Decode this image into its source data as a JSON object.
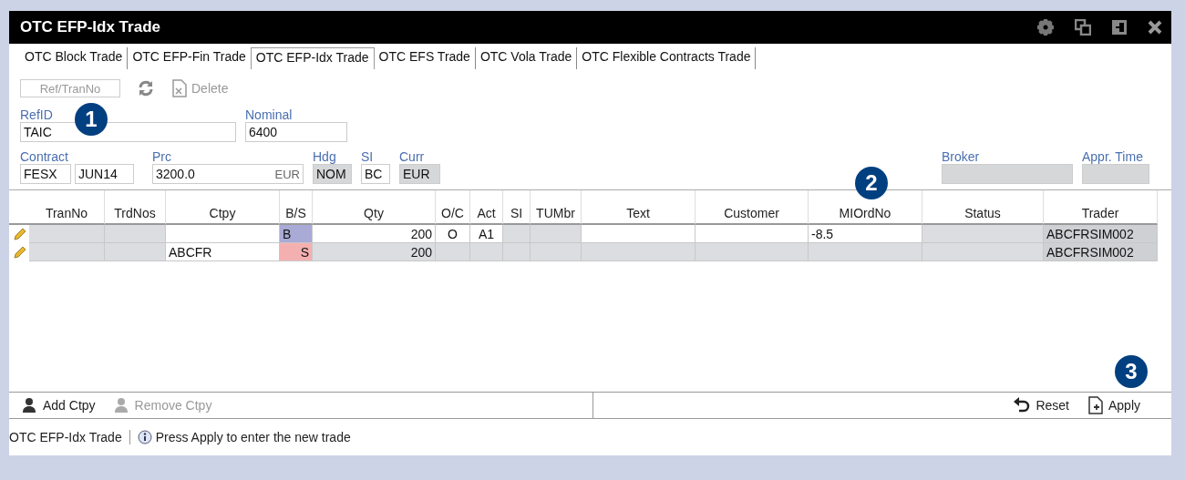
{
  "window": {
    "title": "OTC EFP-Idx Trade"
  },
  "tabs": [
    {
      "label": "OTC Block Trade",
      "selected": false
    },
    {
      "label": "OTC EFP-Fin Trade",
      "selected": false
    },
    {
      "label": "OTC EFP-Idx Trade",
      "selected": true
    },
    {
      "label": "OTC EFS Trade",
      "selected": false
    },
    {
      "label": "OTC Vola Trade",
      "selected": false
    },
    {
      "label": "OTC Flexible Contracts Trade",
      "selected": false
    }
  ],
  "toolbar": {
    "ref_field": {
      "placeholder": "Ref/TranNo",
      "disabled": true
    },
    "delete_label": "Delete"
  },
  "form_row_1": [
    {
      "label": "RefID",
      "values": [
        "TAIC"
      ],
      "disabled": false
    },
    {
      "label": "Nominal",
      "values": [
        "6400"
      ],
      "disabled": false
    }
  ],
  "form_row_2": [
    {
      "label": "Contract",
      "values": [
        "FESX",
        "JUN14"
      ],
      "disabled": false
    },
    {
      "label": "Prc",
      "values": [
        "3200.0"
      ],
      "suffix": "EUR",
      "disabled": false
    },
    {
      "label": "Hdg",
      "values": [
        "NOM"
      ],
      "disabled": true
    },
    {
      "label": "SI",
      "values": [
        "BC"
      ],
      "disabled": false
    },
    {
      "label": "Curr",
      "values": [
        "EUR"
      ],
      "disabled": true
    },
    {
      "label": "Broker",
      "disabled": true
    },
    {
      "label": "Appr. Time",
      "disabled": true
    }
  ],
  "table": {
    "columns": [
      "TranNo",
      "TrdNos",
      "Ctpy",
      "B/S",
      "Qty",
      "O/C",
      "Act",
      "SI",
      "TUMbr",
      "Text",
      "Customer",
      "MIOrdNo",
      "Status",
      "Trader"
    ],
    "rows": [
      {
        "cells": [
          {
            "text": "",
            "editable": false
          },
          {
            "text": "",
            "editable": false
          },
          {
            "text": "",
            "editable": true
          },
          {
            "text": "B",
            "color": "#aaaad6"
          },
          {
            "text": "200",
            "editable": true
          },
          {
            "text": "O",
            "editable": true
          },
          {
            "text": "A1",
            "editable": true
          },
          {
            "text": "",
            "editable": false
          },
          {
            "text": "",
            "editable": false
          },
          {
            "text": "",
            "editable": true
          },
          {
            "text": "",
            "editable": true
          },
          {
            "text": "-8.5",
            "editable": true
          },
          {
            "text": "",
            "editable": false
          },
          {
            "text": "ABCFRSIM002",
            "editable": false
          }
        ]
      },
      {
        "cells": [
          {
            "text": "",
            "editable": false
          },
          {
            "text": "",
            "editable": false
          },
          {
            "text": "ABCFR",
            "editable": true
          },
          {
            "text": "S",
            "color": "#f4b0b0"
          },
          {
            "text": "200",
            "editable": false
          },
          {
            "text": "",
            "editable": false
          },
          {
            "text": "",
            "editable": false
          },
          {
            "text": "",
            "editable": false
          },
          {
            "text": "",
            "editable": false
          },
          {
            "text": "",
            "editable": false
          },
          {
            "text": "",
            "editable": false
          },
          {
            "text": "",
            "editable": false
          },
          {
            "text": "",
            "editable": false
          },
          {
            "text": "ABCFRSIM002",
            "editable": false
          }
        ]
      }
    ]
  },
  "bottom_actions": [
    {
      "label": "Add Ctpy",
      "disabled": false
    },
    {
      "label": "Remove Ctpy",
      "disabled": true
    }
  ],
  "commit_actions": [
    {
      "label": "Reset",
      "kind": "reset"
    },
    {
      "label": "Apply",
      "kind": "apply"
    }
  ],
  "status_bar": {
    "view": "OTC EFP-Idx Trade",
    "message": "Press Apply to enter the new trade"
  },
  "callouts": [
    {
      "number": "1"
    },
    {
      "number": "2"
    },
    {
      "number": "3"
    }
  ]
}
